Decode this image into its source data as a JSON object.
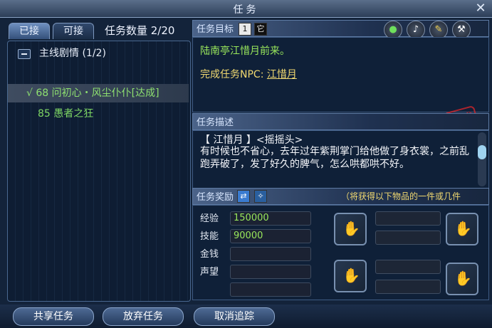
{
  "window": {
    "title": "任务"
  },
  "left": {
    "tabs": [
      {
        "label": "已接"
      },
      {
        "label": "可接"
      }
    ],
    "count_text": "任务数量 2/20",
    "category": "主线剧情 (1/2)",
    "quests": [
      {
        "text": "√ 68 问初心・风尘仆仆[达成]",
        "selected": true
      },
      {
        "text": "85 愚者之狂",
        "selected": false
      }
    ]
  },
  "target": {
    "header": "任务目标",
    "line1": "陆南亭江惜月前来。",
    "npc_label": "完成任务NPC: ",
    "npc_name": "江惜月",
    "stamp": "完成",
    "icons": [
      "1",
      "它"
    ],
    "tool_icons": [
      "gem-icon",
      "speaker-icon",
      "broom-icon",
      "hammer-icon"
    ]
  },
  "desc": {
    "header": "任务描述",
    "speaker": "【 江惜月 】<摇摇头>",
    "body": "有时候也不省心，去年过年紫荆掌门给他做了身衣裳，之前乱跑弄破了，发了好久的脾气，怎么哄都哄不好。"
  },
  "reward": {
    "header": "任务奖励",
    "note": "（将获得以下物品的一件或几件",
    "fields": [
      {
        "label": "经验",
        "value": "150000"
      },
      {
        "label": "技能",
        "value": "90000"
      },
      {
        "label": "金钱",
        "value": ""
      },
      {
        "label": "声望",
        "value": ""
      }
    ]
  },
  "buttons": {
    "share": "共享任务",
    "abandon": "放弃任务",
    "untrack": "取消追踪"
  },
  "colors": {
    "green": "#9ae85b",
    "yellow": "#f0d870",
    "stamp": "#c9252c"
  }
}
